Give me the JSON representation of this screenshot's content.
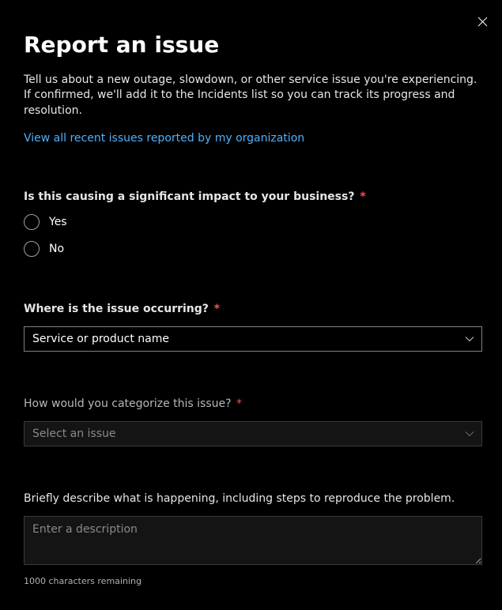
{
  "header": {
    "title": "Report an issue",
    "description": "Tell us about a new outage, slowdown, or other service issue you're experiencing. If confirmed, we'll add it to the Incidents list so you can track its progress and resolution.",
    "link": "View all recent issues reported by my organization"
  },
  "impact": {
    "label": "Is this causing a significant impact to your business?",
    "required": "*",
    "options": {
      "yes": "Yes",
      "no": "No"
    }
  },
  "where": {
    "label": "Where is the issue occurring?",
    "required": "*",
    "placeholder": "Service or product name"
  },
  "category": {
    "label": "How would you categorize this issue?",
    "required": "*",
    "placeholder": "Select an issue"
  },
  "describe": {
    "label": "Briefly describe what is happening, including steps to reproduce the problem.",
    "placeholder": "Enter a description",
    "counter": "1000 characters remaining"
  }
}
